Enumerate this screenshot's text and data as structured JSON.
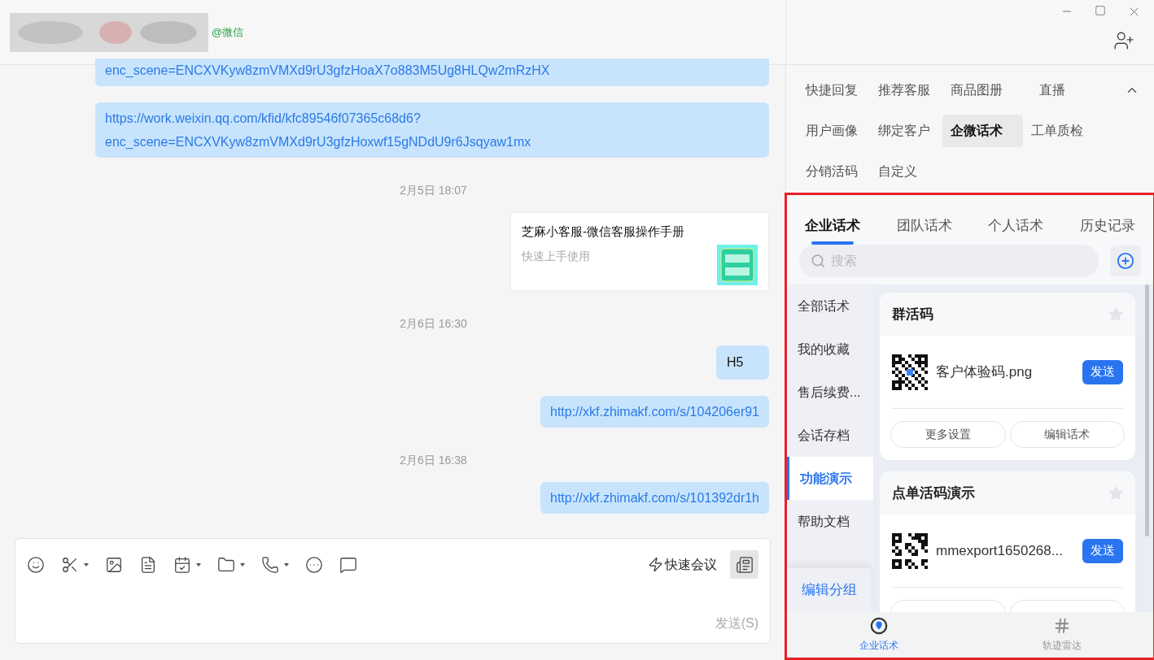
{
  "header": {
    "contact_suffix": "@微信"
  },
  "messages": [
    {
      "kind": "link",
      "lines": [
        "enc_scene=ENCXVKyw8zmVMXd9rU3gfzHoaX7o883M5Ug8HLQw2mRzHX"
      ]
    },
    {
      "kind": "link",
      "lines": [
        "https://work.weixin.qq.com/kfid/kfc89546f07365c68d6?",
        "enc_scene=ENCXVKyw8zmVMXd9rU3gfzHoxwf15gNDdU9r6Jsqyaw1mx"
      ]
    },
    {
      "kind": "time",
      "text": "2月5日 18:07"
    },
    {
      "kind": "card",
      "title": "芝麻小客服-微信客服操作手册",
      "subtitle": "快速上手使用"
    },
    {
      "kind": "time",
      "text": "2月6日 16:30"
    },
    {
      "kind": "text",
      "text": "H5"
    },
    {
      "kind": "link",
      "lines": [
        "http://xkf.zhimakf.com/s/104206er91"
      ]
    },
    {
      "kind": "time",
      "text": "2月6日 16:38"
    },
    {
      "kind": "link",
      "lines": [
        "http://xkf.zhimakf.com/s/101392dr1h"
      ]
    }
  ],
  "composer": {
    "quick_meeting": "快速会议",
    "send": "发送(S)"
  },
  "feature_tabs": [
    {
      "label": "快捷回复",
      "selected": false
    },
    {
      "label": "推荐客服",
      "selected": false
    },
    {
      "label": "商品图册",
      "selected": false
    },
    {
      "label": "直播",
      "selected": false
    },
    {
      "label": "用户画像",
      "selected": false
    },
    {
      "label": "绑定客户",
      "selected": false
    },
    {
      "label": "企微话术",
      "selected": true
    },
    {
      "label": "工单质检",
      "selected": false
    },
    {
      "label": "分销活码",
      "selected": false
    },
    {
      "label": "自定义",
      "selected": false
    }
  ],
  "script_panel": {
    "tabs": [
      {
        "label": "企业话术",
        "selected": true
      },
      {
        "label": "团队话术",
        "selected": false
      },
      {
        "label": "个人话术",
        "selected": false
      },
      {
        "label": "历史记录",
        "selected": false
      }
    ],
    "search": {
      "placeholder": "搜索"
    },
    "groups": [
      {
        "label": "全部话术",
        "selected": false
      },
      {
        "label": "我的收藏",
        "selected": false
      },
      {
        "label": "售后续费...",
        "selected": false
      },
      {
        "label": "会话存档",
        "selected": false
      },
      {
        "label": "功能演示",
        "selected": true
      },
      {
        "label": "帮助文档",
        "selected": false
      }
    ],
    "edit_group": "编辑分组",
    "cards": [
      {
        "title": "群活码",
        "starred": false,
        "file": "客户体验码.png",
        "send": "发送",
        "actions": [
          "更多设置",
          "编辑话术"
        ]
      },
      {
        "title": "点单活码演示",
        "starred": false,
        "file": "mmexport1650268...",
        "send": "发送"
      }
    ],
    "bottom_nav": [
      {
        "label": "企业话术",
        "selected": true
      },
      {
        "label": "轨迹雷达",
        "selected": false
      }
    ]
  }
}
